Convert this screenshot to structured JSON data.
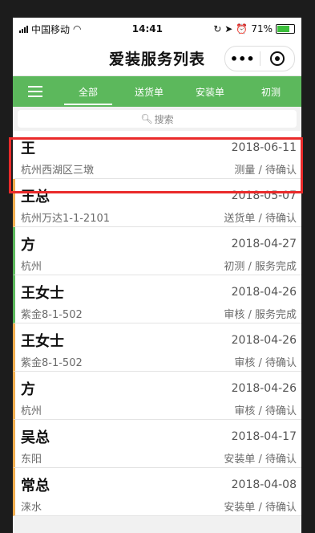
{
  "status_bar": {
    "carrier": "中国移动",
    "time": "14:41",
    "battery": "71%",
    "battery_level": 0.71
  },
  "title": "爱装服务列表",
  "capsule": {
    "more_label": "•••"
  },
  "tabs": [
    {
      "label": "全部",
      "active": true
    },
    {
      "label": "送货单",
      "active": false
    },
    {
      "label": "安装单",
      "active": false
    },
    {
      "label": "初测",
      "active": false
    }
  ],
  "search": {
    "placeholder": "搜索"
  },
  "orders": [
    {
      "name": "王",
      "date": "2018-06-11",
      "address": "杭州西湖区三墩",
      "status": "测量 / 待确认",
      "accent": "none"
    },
    {
      "name": "王总",
      "date": "2018-05-07",
      "address": "杭州万达1-1-2101",
      "status": "送货单 / 待确认",
      "accent": "orange"
    },
    {
      "name": "方",
      "date": "2018-04-27",
      "address": "杭州",
      "status": "初测 / 服务完成",
      "accent": "green"
    },
    {
      "name": "王女士",
      "date": "2018-04-26",
      "address": "紫金8-1-502",
      "status": "审核 / 服务完成",
      "accent": "green"
    },
    {
      "name": "王女士",
      "date": "2018-04-26",
      "address": "紫金8-1-502",
      "status": "审核 / 待确认",
      "accent": "orange"
    },
    {
      "name": "方",
      "date": "2018-04-26",
      "address": "杭州",
      "status": "审核 / 待确认",
      "accent": "orange"
    },
    {
      "name": "吴总",
      "date": "2018-04-17",
      "address": "东阳",
      "status": "安装单 / 待确认",
      "accent": "orange"
    },
    {
      "name": "常总",
      "date": "2018-04-08",
      "address": "涞水",
      "status": "安装单 / 待确认",
      "accent": "orange"
    }
  ],
  "colors": {
    "accent_green": "#5cb85c",
    "accent_orange": "#f0ad4e",
    "highlight_red": "#ea2a2a"
  }
}
